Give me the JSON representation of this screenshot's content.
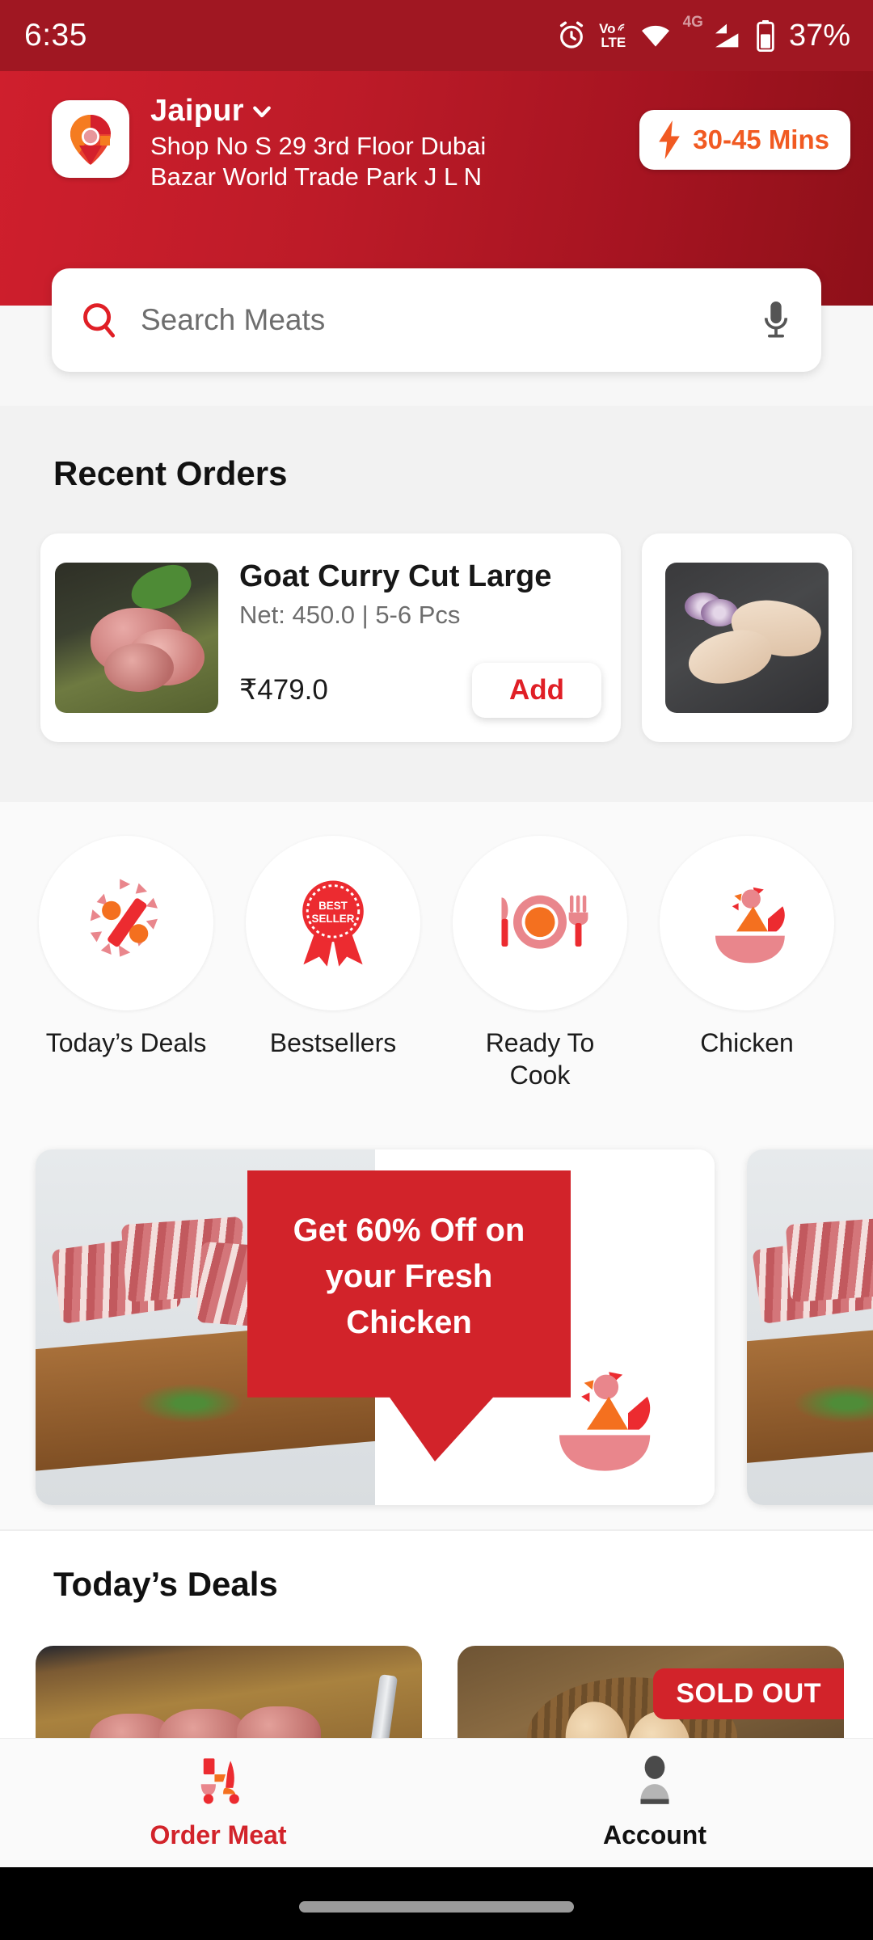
{
  "status_bar": {
    "time": "6:35",
    "battery_percent": "37%",
    "network_label": "4G",
    "volte_top": "Vo",
    "volte_bottom": "LTE",
    "icons": [
      "alarm-icon",
      "volte-icon",
      "wifi-icon",
      "signal-icon",
      "battery-icon"
    ]
  },
  "header": {
    "brand_logo": "location-pin-logo",
    "city": "Jaipur",
    "city_chevron": "chevron-down-icon",
    "address": "Shop No S 29 3rd Floor Dubai Bazar World Trade Park J L N",
    "eta_badge": {
      "icon": "lightning-bolt-icon",
      "label": "30-45 Mins"
    },
    "colors": {
      "gradient_start": "#cf1f2d",
      "gradient_end": "#8e1019",
      "eta_text": "#f15a22"
    }
  },
  "search": {
    "placeholder": "Search Meats",
    "search_icon": "search-icon",
    "mic_icon": "microphone-icon"
  },
  "recent_orders": {
    "title": "Recent Orders",
    "items": [
      {
        "name": "Goat Curry Cut Large",
        "net": "Net: 450.0 | 5-6 Pcs",
        "price": "₹479.0",
        "add_label": "Add",
        "image": "goat-curry-cut-photo"
      },
      {
        "name": "",
        "net": "",
        "price": "",
        "add_label": "",
        "image": "chicken-legs-photo"
      }
    ]
  },
  "categories": [
    {
      "label": "Today’s Deals",
      "icon": "percent-discount-icon"
    },
    {
      "label": "Bestsellers",
      "icon": "best-seller-ribbon-icon"
    },
    {
      "label": "Ready To Cook",
      "icon": "plate-cutlery-icon"
    },
    {
      "label": "Chicken",
      "icon": "chicken-bowl-icon"
    }
  ],
  "banners": [
    {
      "text": "Get 60% Off on your Fresh Chicken",
      "image": "bacon-on-board-photo",
      "mascot": "chicken-bowl-icon"
    },
    {
      "text": "",
      "image": "bacon-on-board-photo",
      "mascot": ""
    }
  ],
  "todays_deals": {
    "title": "Today’s Deals",
    "cards": [
      {
        "image": "meat-chunks-photo",
        "badge": ""
      },
      {
        "image": "eggs-basket-photo",
        "badge": "SOLD OUT"
      }
    ]
  },
  "bottom_nav": {
    "items": [
      {
        "label": "Order Meat",
        "icon": "scooter-delivery-icon",
        "active": true
      },
      {
        "label": "Account",
        "icon": "person-icon",
        "active": false
      }
    ],
    "active_color": "#d2232a"
  }
}
